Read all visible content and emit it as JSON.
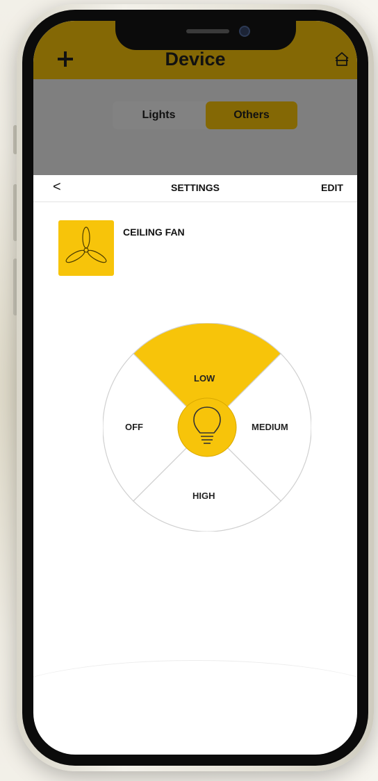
{
  "header": {
    "title": "Device"
  },
  "tabs": [
    {
      "label": "Lights",
      "active": false
    },
    {
      "label": "Others",
      "active": true
    }
  ],
  "nav": {
    "back": "<",
    "title": "SETTINGS",
    "edit": "EDIT"
  },
  "device": {
    "name": "CEILING FAN",
    "icon": "ceiling-fan-icon"
  },
  "speed_dial": {
    "options": [
      "LOW",
      "MEDIUM",
      "HIGH",
      "OFF"
    ],
    "selected": "LOW",
    "center_icon": "light-bulb-icon"
  },
  "colors": {
    "header": "#846805",
    "accent": "#f7c40a",
    "tab_bar": "#7f7f7f"
  }
}
